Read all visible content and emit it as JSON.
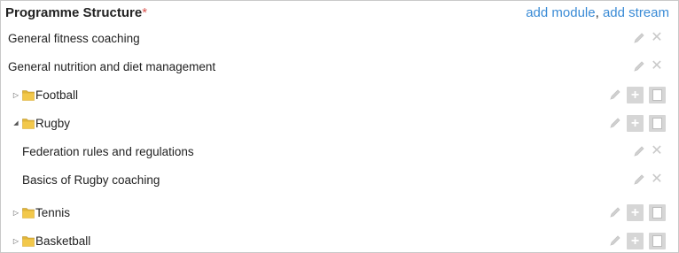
{
  "header": {
    "title": "Programme Structure",
    "required_mark": "*",
    "add_module": "add module",
    "separator": ",",
    "add_stream": "add stream"
  },
  "rows": [
    {
      "type": "module",
      "label": "General fitness coaching",
      "indent": 0
    },
    {
      "type": "module",
      "label": "General nutrition and diet management",
      "indent": 0
    },
    {
      "type": "stream",
      "label": "Football",
      "expanded": false
    },
    {
      "type": "stream",
      "label": "Rugby",
      "expanded": true
    },
    {
      "type": "module",
      "label": "Federation rules and regulations",
      "indent": 1
    },
    {
      "type": "module",
      "label": "Basics of Rugby coaching",
      "indent": 1
    },
    {
      "type": "stream",
      "label": "Tennis",
      "expanded": false
    },
    {
      "type": "stream",
      "label": "Basketball",
      "expanded": false
    }
  ],
  "icons": {
    "collapsed": "triangle-right-icon",
    "expanded": "triangle-down-icon",
    "folder": "folder-icon",
    "edit": "pencil-icon",
    "delete": "close-icon",
    "add": "plus-icon",
    "stop": "stop-icon"
  },
  "colors": {
    "link": "#3a8bd6",
    "required": "#d9534f",
    "action_icon": "#c9c9c9",
    "action_button_bg": "#d6d6d6",
    "folder_yellow": "#f2c84b"
  }
}
